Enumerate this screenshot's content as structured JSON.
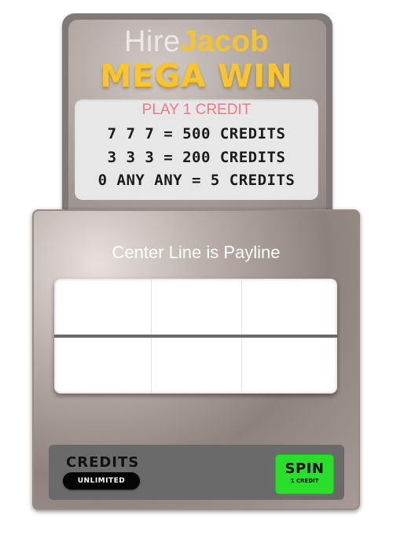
{
  "header": {
    "logo_part1": "Hire",
    "logo_part2": "Jacob",
    "mega_win": "MEGA WIN"
  },
  "paytable": {
    "play_label": "PLAY 1 CREDIT",
    "rows": [
      "7 7 7 = 500 CREDITS",
      "3 3 3 = 200 CREDITS",
      "0 ANY ANY = 5 CREDITS"
    ]
  },
  "machine": {
    "payline_title": "Center Line is Payline"
  },
  "controls": {
    "credits_label": "CREDITS",
    "credits_value": "UNLIMITED",
    "spin_label": "SPIN",
    "spin_sub": "1 CREDIT"
  },
  "colors": {
    "gold": "#f9c52c",
    "play_label": "#f07a7e",
    "spin_button": "#2adf2a",
    "panel": "#6a6a6a"
  }
}
